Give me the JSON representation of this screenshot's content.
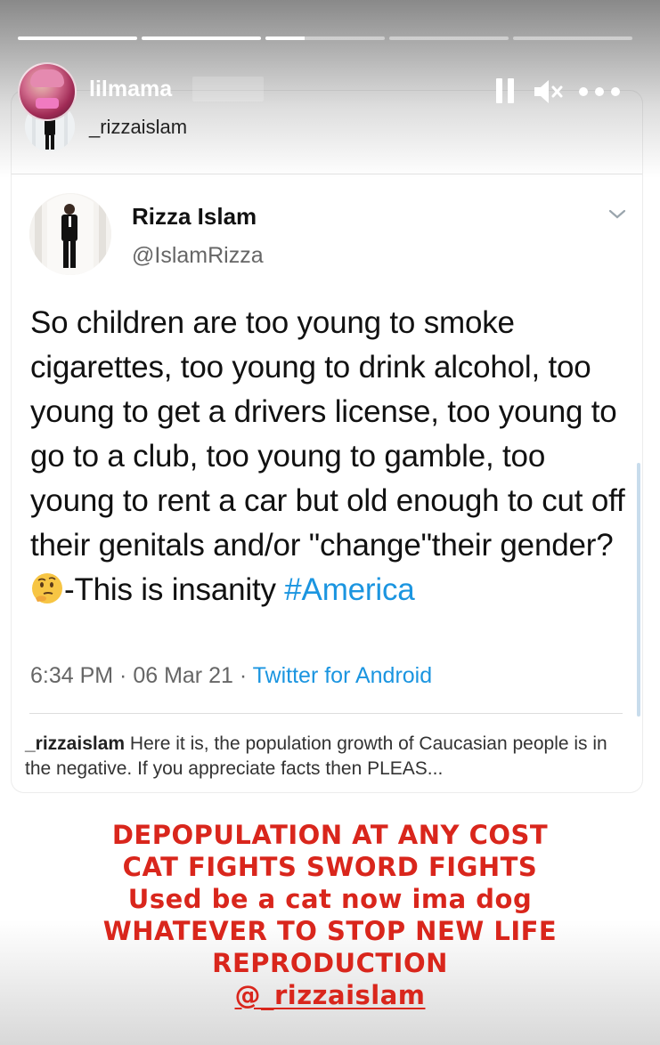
{
  "story": {
    "username": "lilmama",
    "progress": [
      1,
      1,
      0.33,
      0,
      0
    ]
  },
  "shared_post": {
    "username": "_rizzaislam"
  },
  "tweet": {
    "name": "Rizza Islam",
    "handle": "@IslamRizza",
    "text_before_emoji": "So children are too young to smoke cigarettes, too young to drink alcohol, too young to get a drivers license, too young to go to a club, too young to gamble, too young to rent a car but old enough to cut off their genitals and/or \"change\"their gender?",
    "text_after_emoji": "-This is insanity ",
    "hashtag": "#America",
    "emoji_icon": "thinking-face-emoji",
    "time_date": "6:34 PM · 06 Mar 21 · ",
    "source": "Twitter for Android"
  },
  "caption": {
    "username": "_rizzaislam",
    "text": " Here it is, the population growth of Caucasian people is in the negative. If you appreciate facts then PLEAS..."
  },
  "overlay_text": {
    "line1": "DEPOPULATION AT ANY COST",
    "line2": "CAT FIGHTS SWORD FIGHTS",
    "line3": "Used be a cat now ima dog",
    "line4": "WHATEVER TO STOP NEW LIFE",
    "line5": "REPRODUCTION",
    "mention": "@_rizzaislam",
    "color": "#d9261c"
  },
  "colors": {
    "link_blue": "#1b95e0",
    "overlay_red": "#d9261c"
  }
}
